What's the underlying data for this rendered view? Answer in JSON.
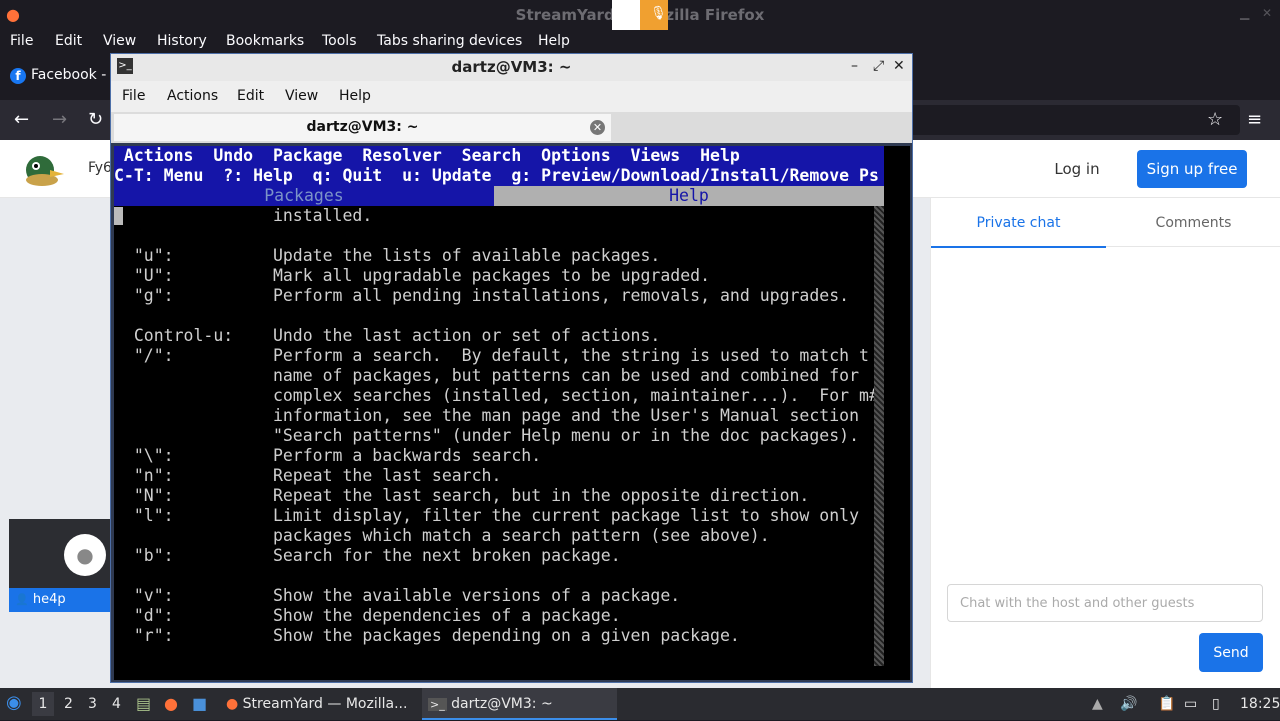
{
  "firefox": {
    "window_title": "StreamYard — Mozilla Firefox",
    "menu": [
      "File",
      "Edit",
      "View",
      "History",
      "Bookmarks",
      "Tools",
      "Tabs sharing devices",
      "Help"
    ],
    "tab_label": "Facebook - Facebook"
  },
  "page": {
    "title_fragment": "Fy6",
    "login_label": "Log in",
    "signup_label": "Sign up free",
    "tabs": [
      "Private chat",
      "Comments"
    ],
    "chat_placeholder": "Chat with the host and other guests",
    "send_label": "Send",
    "guest_name": "he4p",
    "colors": {
      "accent": "#1a73e8"
    }
  },
  "terminal": {
    "title": "dartz@VM3: ~",
    "menu": [
      "File",
      "Actions",
      "Edit",
      "View",
      "Help"
    ],
    "tab_label": "dartz@VM3: ~",
    "aptitude": {
      "menu_line": " Actions  Undo  Package  Resolver  Search  Options  Views  Help",
      "keys_line": "C-T: Menu  ?: Help  q: Quit  u: Update  g: Preview/Download/Install/Remove Ps",
      "tab_packages": "Packages",
      "tab_help": "Help",
      "lines": [
        "                installed.",
        "",
        "  \"u\":          Update the lists of available packages.",
        "  \"U\":          Mark all upgradable packages to be upgraded.",
        "  \"g\":          Perform all pending installations, removals, and upgrades.",
        "",
        "  Control-u:    Undo the last action or set of actions.",
        "  \"/\":          Perform a search.  By default, the string is used to match t",
        "                name of packages, but patterns can be used and combined for",
        "                complex searches (installed, section, maintainer...).  For m#",
        "                information, see the man page and the User's Manual section",
        "                \"Search patterns\" (under Help menu or in the doc packages).",
        "  \"\\\":          Perform a backwards search.",
        "  \"n\":          Repeat the last search.",
        "  \"N\":          Repeat the last search, but in the opposite direction.",
        "  \"l\":          Limit display, filter the current package list to show only",
        "                packages which match a search pattern (see above).",
        "  \"b\":          Search for the next broken package.",
        "",
        "  \"v\":          Show the available versions of a package.",
        "  \"d\":          Show the dependencies of a package.",
        "  \"r\":          Show the packages depending on a given package."
      ]
    }
  },
  "taskbar": {
    "workspaces": [
      "1",
      "2",
      "3",
      "4"
    ],
    "tasks": [
      "StreamYard — Mozilla...",
      "dartz@VM3: ~"
    ],
    "clock": "18:25"
  }
}
